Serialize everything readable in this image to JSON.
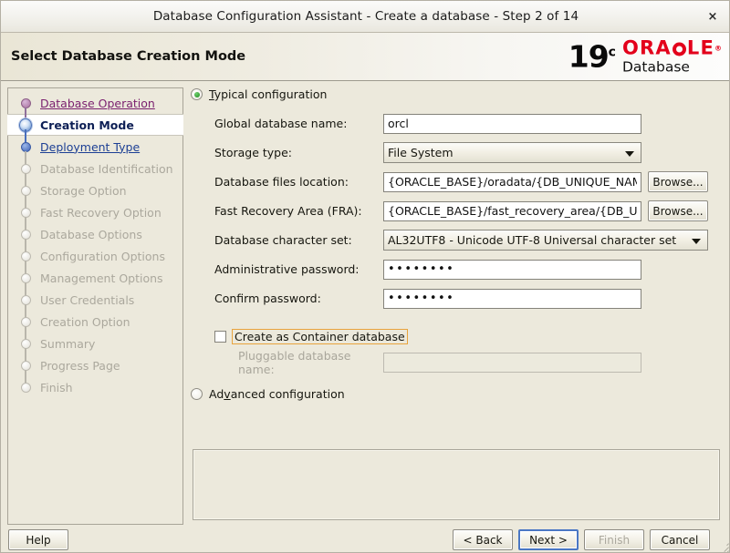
{
  "window": {
    "title": "Database Configuration Assistant - Create a database - Step 2 of 14",
    "close_label": "×"
  },
  "banner": {
    "title": "Select Database Creation Mode",
    "logo_version": "19",
    "logo_version_sup": "c",
    "logo_oracle_pre": "ORA",
    "logo_oracle_post": "LE",
    "logo_reg": "®",
    "logo_product": "Database",
    "accent_red": "#e3001b"
  },
  "sidebar": {
    "items": [
      {
        "label": "Database Operation",
        "state": "visited"
      },
      {
        "label": "Creation Mode",
        "state": "current"
      },
      {
        "label": "Deployment Type",
        "state": "next"
      },
      {
        "label": "Database Identification",
        "state": "disabled"
      },
      {
        "label": "Storage Option",
        "state": "disabled"
      },
      {
        "label": "Fast Recovery Option",
        "state": "disabled"
      },
      {
        "label": "Database Options",
        "state": "disabled"
      },
      {
        "label": "Configuration Options",
        "state": "disabled"
      },
      {
        "label": "Management Options",
        "state": "disabled"
      },
      {
        "label": "User Credentials",
        "state": "disabled"
      },
      {
        "label": "Creation Option",
        "state": "disabled"
      },
      {
        "label": "Summary",
        "state": "disabled"
      },
      {
        "label": "Progress Page",
        "state": "disabled"
      },
      {
        "label": "Finish",
        "state": "disabled"
      }
    ]
  },
  "main": {
    "typical_radio_label": "Typical configuration",
    "typical_selected": true,
    "advanced_radio_label": "Advanced configuration",
    "advanced_selected": false,
    "fields": {
      "global_db_name_label": "Global database name:",
      "global_db_name_value": "orcl",
      "storage_type_label": "Storage type:",
      "storage_type_value": "File System",
      "db_files_location_label": "Database files location:",
      "db_files_location_value": "{ORACLE_BASE}/oradata/{DB_UNIQUE_NAME}",
      "fra_label": "Fast Recovery Area (FRA):",
      "fra_value": "{ORACLE_BASE}/fast_recovery_area/{DB_UNIQU",
      "charset_label": "Database character set:",
      "charset_value": "AL32UTF8 - Unicode UTF-8 Universal character set",
      "admin_password_label": "Administrative password:",
      "admin_password_value": "••••••••",
      "confirm_password_label": "Confirm password:",
      "confirm_password_value": "••••••••",
      "browse_label": "Browse...",
      "container_db_label": "Create as Container database",
      "container_db_checked": false,
      "pluggable_db_label": "Pluggable database name:",
      "pluggable_db_value": ""
    }
  },
  "footer": {
    "help_label": "Help",
    "back_label": "< Back",
    "next_label": "Next >",
    "finish_label": "Finish",
    "cancel_label": "Cancel"
  }
}
